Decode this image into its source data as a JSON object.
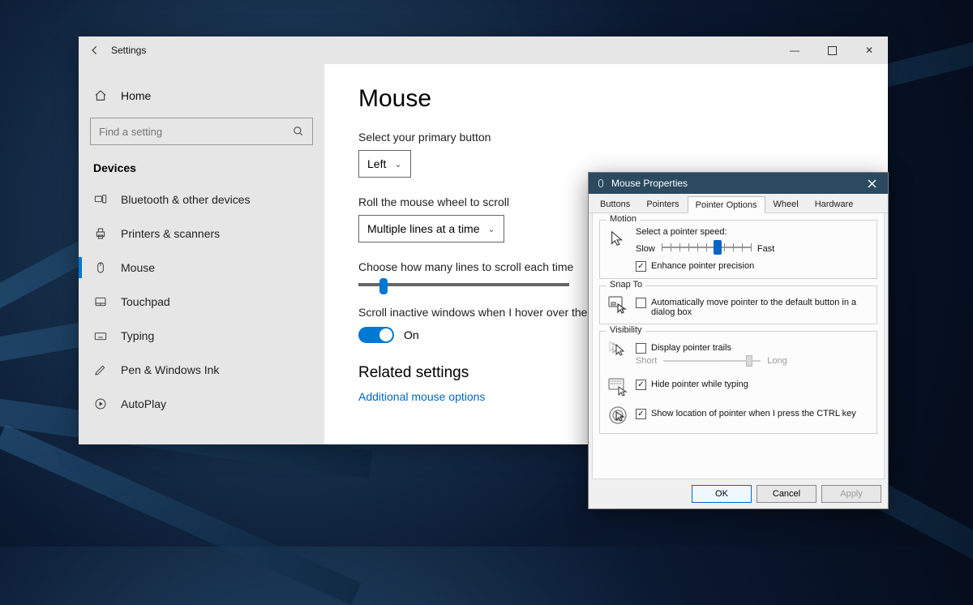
{
  "window": {
    "title": "Settings",
    "controls": {
      "minimize": "—",
      "maximize": "▢",
      "close": "✕"
    }
  },
  "sidebar": {
    "home": "Home",
    "search_placeholder": "Find a setting",
    "category": "Devices",
    "items": [
      {
        "label": "Bluetooth & other devices",
        "active": false
      },
      {
        "label": "Printers & scanners",
        "active": false
      },
      {
        "label": "Mouse",
        "active": true
      },
      {
        "label": "Touchpad",
        "active": false
      },
      {
        "label": "Typing",
        "active": false
      },
      {
        "label": "Pen & Windows Ink",
        "active": false
      },
      {
        "label": "AutoPlay",
        "active": false
      }
    ]
  },
  "main": {
    "heading": "Mouse",
    "primary_button_label": "Select your primary button",
    "primary_button_value": "Left",
    "roll_label": "Roll the mouse wheel to scroll",
    "roll_value": "Multiple lines at a time",
    "lines_label": "Choose how many lines to scroll each time",
    "lines_percent": 10,
    "inactive_label": "Scroll inactive windows when I hover over them",
    "inactive_state": "On",
    "related_heading": "Related settings",
    "related_link": "Additional mouse options"
  },
  "dialog": {
    "title": "Mouse Properties",
    "tabs": [
      "Buttons",
      "Pointers",
      "Pointer Options",
      "Wheel",
      "Hardware"
    ],
    "active_tab": "Pointer Options",
    "motion": {
      "title": "Motion",
      "speed_label": "Select a pointer speed:",
      "slow": "Slow",
      "fast": "Fast",
      "speed_percent": 60,
      "enhance_checked": true,
      "enhance_label": "Enhance pointer precision"
    },
    "snap": {
      "title": "Snap To",
      "checked": false,
      "label": "Automatically move pointer to the default button in a dialog box"
    },
    "visibility": {
      "title": "Visibility",
      "trails_checked": false,
      "trails_label": "Display pointer trails",
      "short": "Short",
      "long": "Long",
      "trails_percent": 85,
      "hide_checked": true,
      "hide_label": "Hide pointer while typing",
      "ctrl_checked": true,
      "ctrl_label": "Show location of pointer when I press the CTRL key"
    },
    "buttons": {
      "ok": "OK",
      "cancel": "Cancel",
      "apply": "Apply"
    }
  }
}
